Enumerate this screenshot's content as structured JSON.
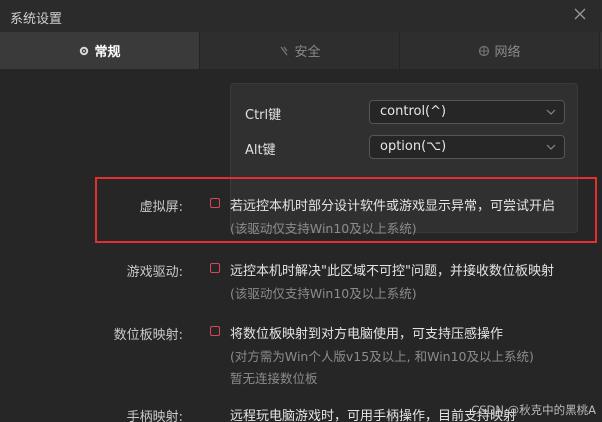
{
  "window": {
    "title": "系统设置"
  },
  "tabs": [
    {
      "label": "常规",
      "icon": "gear-icon"
    },
    {
      "label": "安全",
      "icon": "shield-icon"
    },
    {
      "label": "网络",
      "icon": "globe-icon"
    }
  ],
  "keymap": {
    "ctrl": {
      "label": "Ctrl键",
      "value": "control(^)"
    },
    "alt": {
      "label": "Alt键",
      "value": "option(⌥)"
    }
  },
  "settings": {
    "virtual_screen": {
      "label": "虚拟屏:",
      "text": "若远控本机时部分设计软件或游戏显示异常，可尝试开启",
      "note": "(该驱动仅支持Win10及以上系统)"
    },
    "game_driver": {
      "label": "游戏驱动:",
      "text": "远控本机时解决\"此区域不可控\"问题，并接收数位板映射",
      "note": "(该驱动仅支持Win10及以上系统)"
    },
    "tablet_mapping": {
      "label": "数位板映射:",
      "text": "将数位板映射到对方电脑使用，可支持压感操作",
      "note": "(对方需为Win个人版v15及以上, 和Win10及以上系统)",
      "status": "暂无连接数位板"
    },
    "gamepad_mapping": {
      "label": "手柄映射:",
      "text": "远程玩电脑游戏时，可用手柄操作，目前支持映射"
    }
  },
  "watermark": "CSDN @秋克中的黑桃A",
  "colors": {
    "checkbox_border": "#d24a5a",
    "highlight": "#e03030"
  }
}
